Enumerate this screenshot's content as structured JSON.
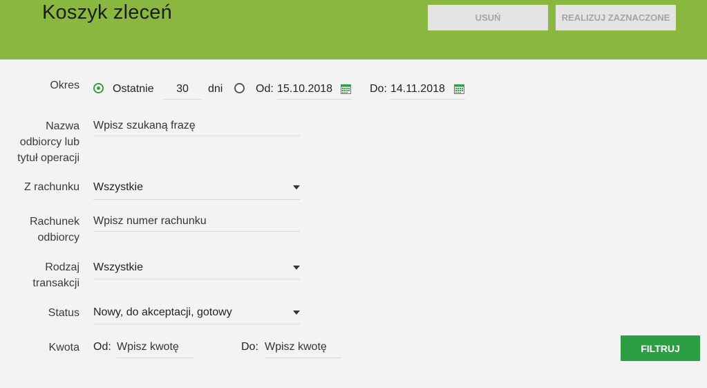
{
  "header": {
    "title": "Koszyk zleceń",
    "delete_label": "USUŃ",
    "execute_label": "REALIZUJ ZAZNACZONE"
  },
  "filters": {
    "period": {
      "label": "Okres",
      "last_label": "Ostatnie",
      "last_value": "30",
      "days_label": "dni",
      "from_label": "Od:",
      "from_date": "15.10.2018",
      "to_label": "Do:",
      "to_date": "14.11.2018",
      "selected": "last"
    },
    "recipient": {
      "label_lines": [
        "Nazwa",
        "odbiorcy lub",
        "tytuł operacji"
      ],
      "placeholder": "Wpisz szukaną frazę"
    },
    "from_account": {
      "label": "Z rachunku",
      "value": "Wszystkie"
    },
    "recipient_account": {
      "label_lines": [
        "Rachunek",
        "odbiorcy"
      ],
      "placeholder": "Wpisz numer rachunku"
    },
    "transaction_type": {
      "label_lines": [
        "Rodzaj",
        "transakcji"
      ],
      "value": "Wszystkie"
    },
    "status": {
      "label": "Status",
      "value": "Nowy, do akceptacji, gotowy"
    },
    "amount": {
      "label": "Kwota",
      "from_label": "Od:",
      "from_placeholder": "Wpisz kwotę",
      "to_label": "Do:",
      "to_placeholder": "Wpisz kwotę"
    }
  },
  "actions": {
    "filter_label": "FILTRUJ"
  },
  "colors": {
    "header_green": "#8ab73f",
    "accent_green": "#2c9f45",
    "background": "#f2f3f2"
  },
  "icons": {
    "calendar": "calendar-icon",
    "dropdown": "chevron-down-icon"
  }
}
